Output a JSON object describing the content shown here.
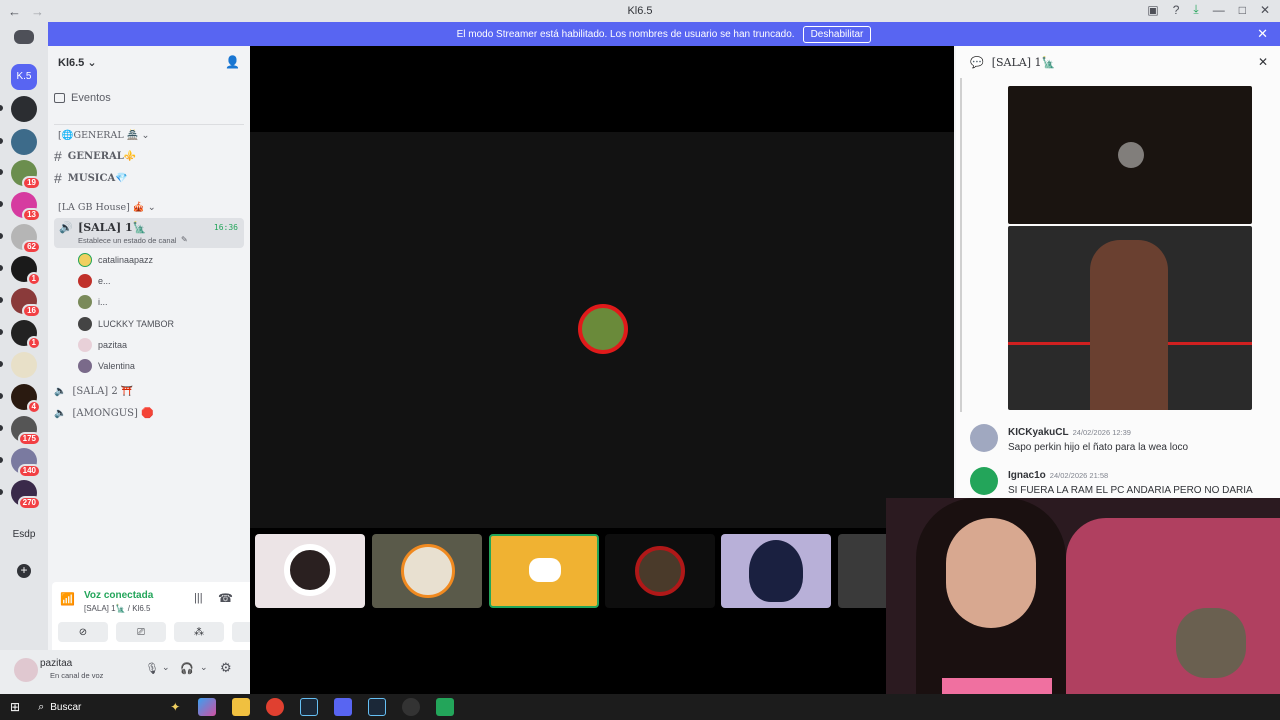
{
  "window": {
    "title": "Kl6.5"
  },
  "banner": {
    "message": "El modo Streamer está habilitado. Los nombres de usuario se han truncado.",
    "button": "Deshabilitar"
  },
  "guilds": [
    {
      "label": "K.5",
      "badge": "",
      "color": "#5865f2"
    },
    {
      "label": "",
      "badge": "",
      "color": "#2b2d31"
    },
    {
      "label": "",
      "badge": "",
      "color": "#3d6b8a"
    },
    {
      "label": "",
      "badge": "19",
      "color": "#6b8e4e"
    },
    {
      "label": "",
      "badge": "13",
      "color": "#d63ba0"
    },
    {
      "label": "",
      "badge": "62",
      "color": "#b5b5b5"
    },
    {
      "label": "",
      "badge": "1",
      "color": "#1a1a1a"
    },
    {
      "label": "",
      "badge": "16",
      "color": "#8a3a3a"
    },
    {
      "label": "",
      "badge": "1",
      "color": "#222222"
    },
    {
      "label": "",
      "badge": "",
      "color": "#e8e0c8"
    },
    {
      "label": "",
      "badge": "4",
      "color": "#2a1a10"
    },
    {
      "label": "",
      "badge": "175",
      "color": "#555555"
    },
    {
      "label": "",
      "badge": "140",
      "color": "#7a7aa0"
    },
    {
      "label": "",
      "badge": "270",
      "color": "#3a2a4a"
    },
    {
      "label": "Esdp",
      "badge": "",
      "color": "#e3e5e8"
    }
  ],
  "server": {
    "name": "Kl6.5",
    "events": "Eventos",
    "categories": [
      {
        "label": "[🌐GENERAL 🏯",
        "channels": [
          "GENERAL⚜️",
          "MUSICA💎"
        ]
      },
      {
        "label": "[LA GB House] 🎪"
      }
    ],
    "active_channel": {
      "name": "[SALA] 1🗽",
      "time": "16:36",
      "status": "Establece un estado de canal"
    },
    "voice_users": [
      "catalinaapazz",
      "e...",
      "i...",
      "LUCKKY TAMBOR",
      "pazitaa",
      "Valentina"
    ],
    "other_voice": [
      "[SALA] 2 ⛩️",
      "[AMONGUS] 🛑"
    ]
  },
  "voice": {
    "status": "Voz conectada",
    "channel": "[SALA] 1🗽 / Kl6.5"
  },
  "user": {
    "name": "pazitaa",
    "status": "En canal de voz"
  },
  "chat": {
    "title": "[SALA] 1🗽",
    "messages": [
      {
        "author": "KICKyakuCL",
        "time": "24/02/2026 12:39",
        "text": "Sapo perkin hijo el ñato para la wea loco"
      },
      {
        "author": "Ignac1o",
        "time": "24/02/2026 21:58",
        "text": "SI FUERA LA RAM EL PC ANDARIA PERO NO DARIA"
      }
    ]
  },
  "taskbar": {
    "search": "Buscar"
  },
  "colors": {
    "blurple": "#5865f2",
    "green": "#23a55a",
    "red": "#f23f43",
    "highlight": "#f0b232"
  }
}
